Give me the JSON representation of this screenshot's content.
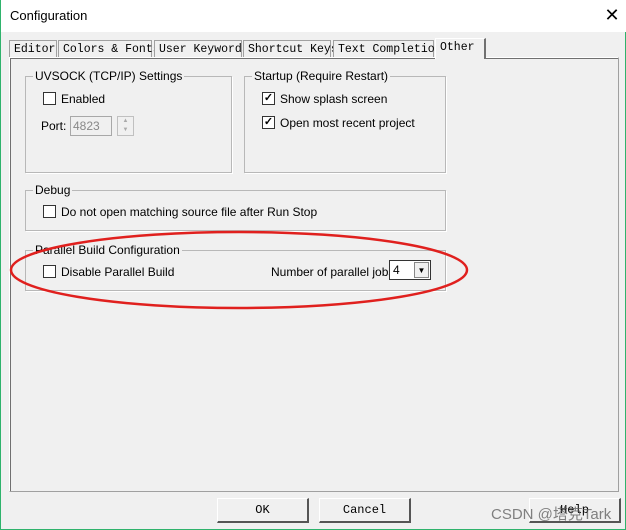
{
  "window": {
    "title": "Configuration",
    "close_icon": "close-icon"
  },
  "tabs": [
    {
      "label": "Editor"
    },
    {
      "label": "Colors & Fonts"
    },
    {
      "label": "User Keywords"
    },
    {
      "label": "Shortcut Keys"
    },
    {
      "label": "Text Completion"
    },
    {
      "label": "Other",
      "active": true
    }
  ],
  "uvsock": {
    "title": "UVSOCK (TCP/IP) Settings",
    "enabled_label": "Enabled",
    "enabled": false,
    "port_label": "Port:",
    "port_value": "4823"
  },
  "startup": {
    "title": "Startup (Require Restart)",
    "splash_label": "Show splash screen",
    "splash": true,
    "recent_label": "Open most recent project",
    "recent": true
  },
  "debug": {
    "title": "Debug",
    "noopen_label": "Do not open matching source file after Run Stop",
    "noopen": false
  },
  "parallel": {
    "title": "Parallel Build Configuration",
    "disable_label": "Disable Parallel Build",
    "disable": false,
    "jobs_label": "Number of parallel jobs:",
    "jobs_value": "4"
  },
  "buttons": {
    "ok": "OK",
    "cancel": "Cancel",
    "help": "Help"
  },
  "annotation": {
    "color": "#e0201e"
  },
  "watermark": "CSDN @塔克Tark"
}
